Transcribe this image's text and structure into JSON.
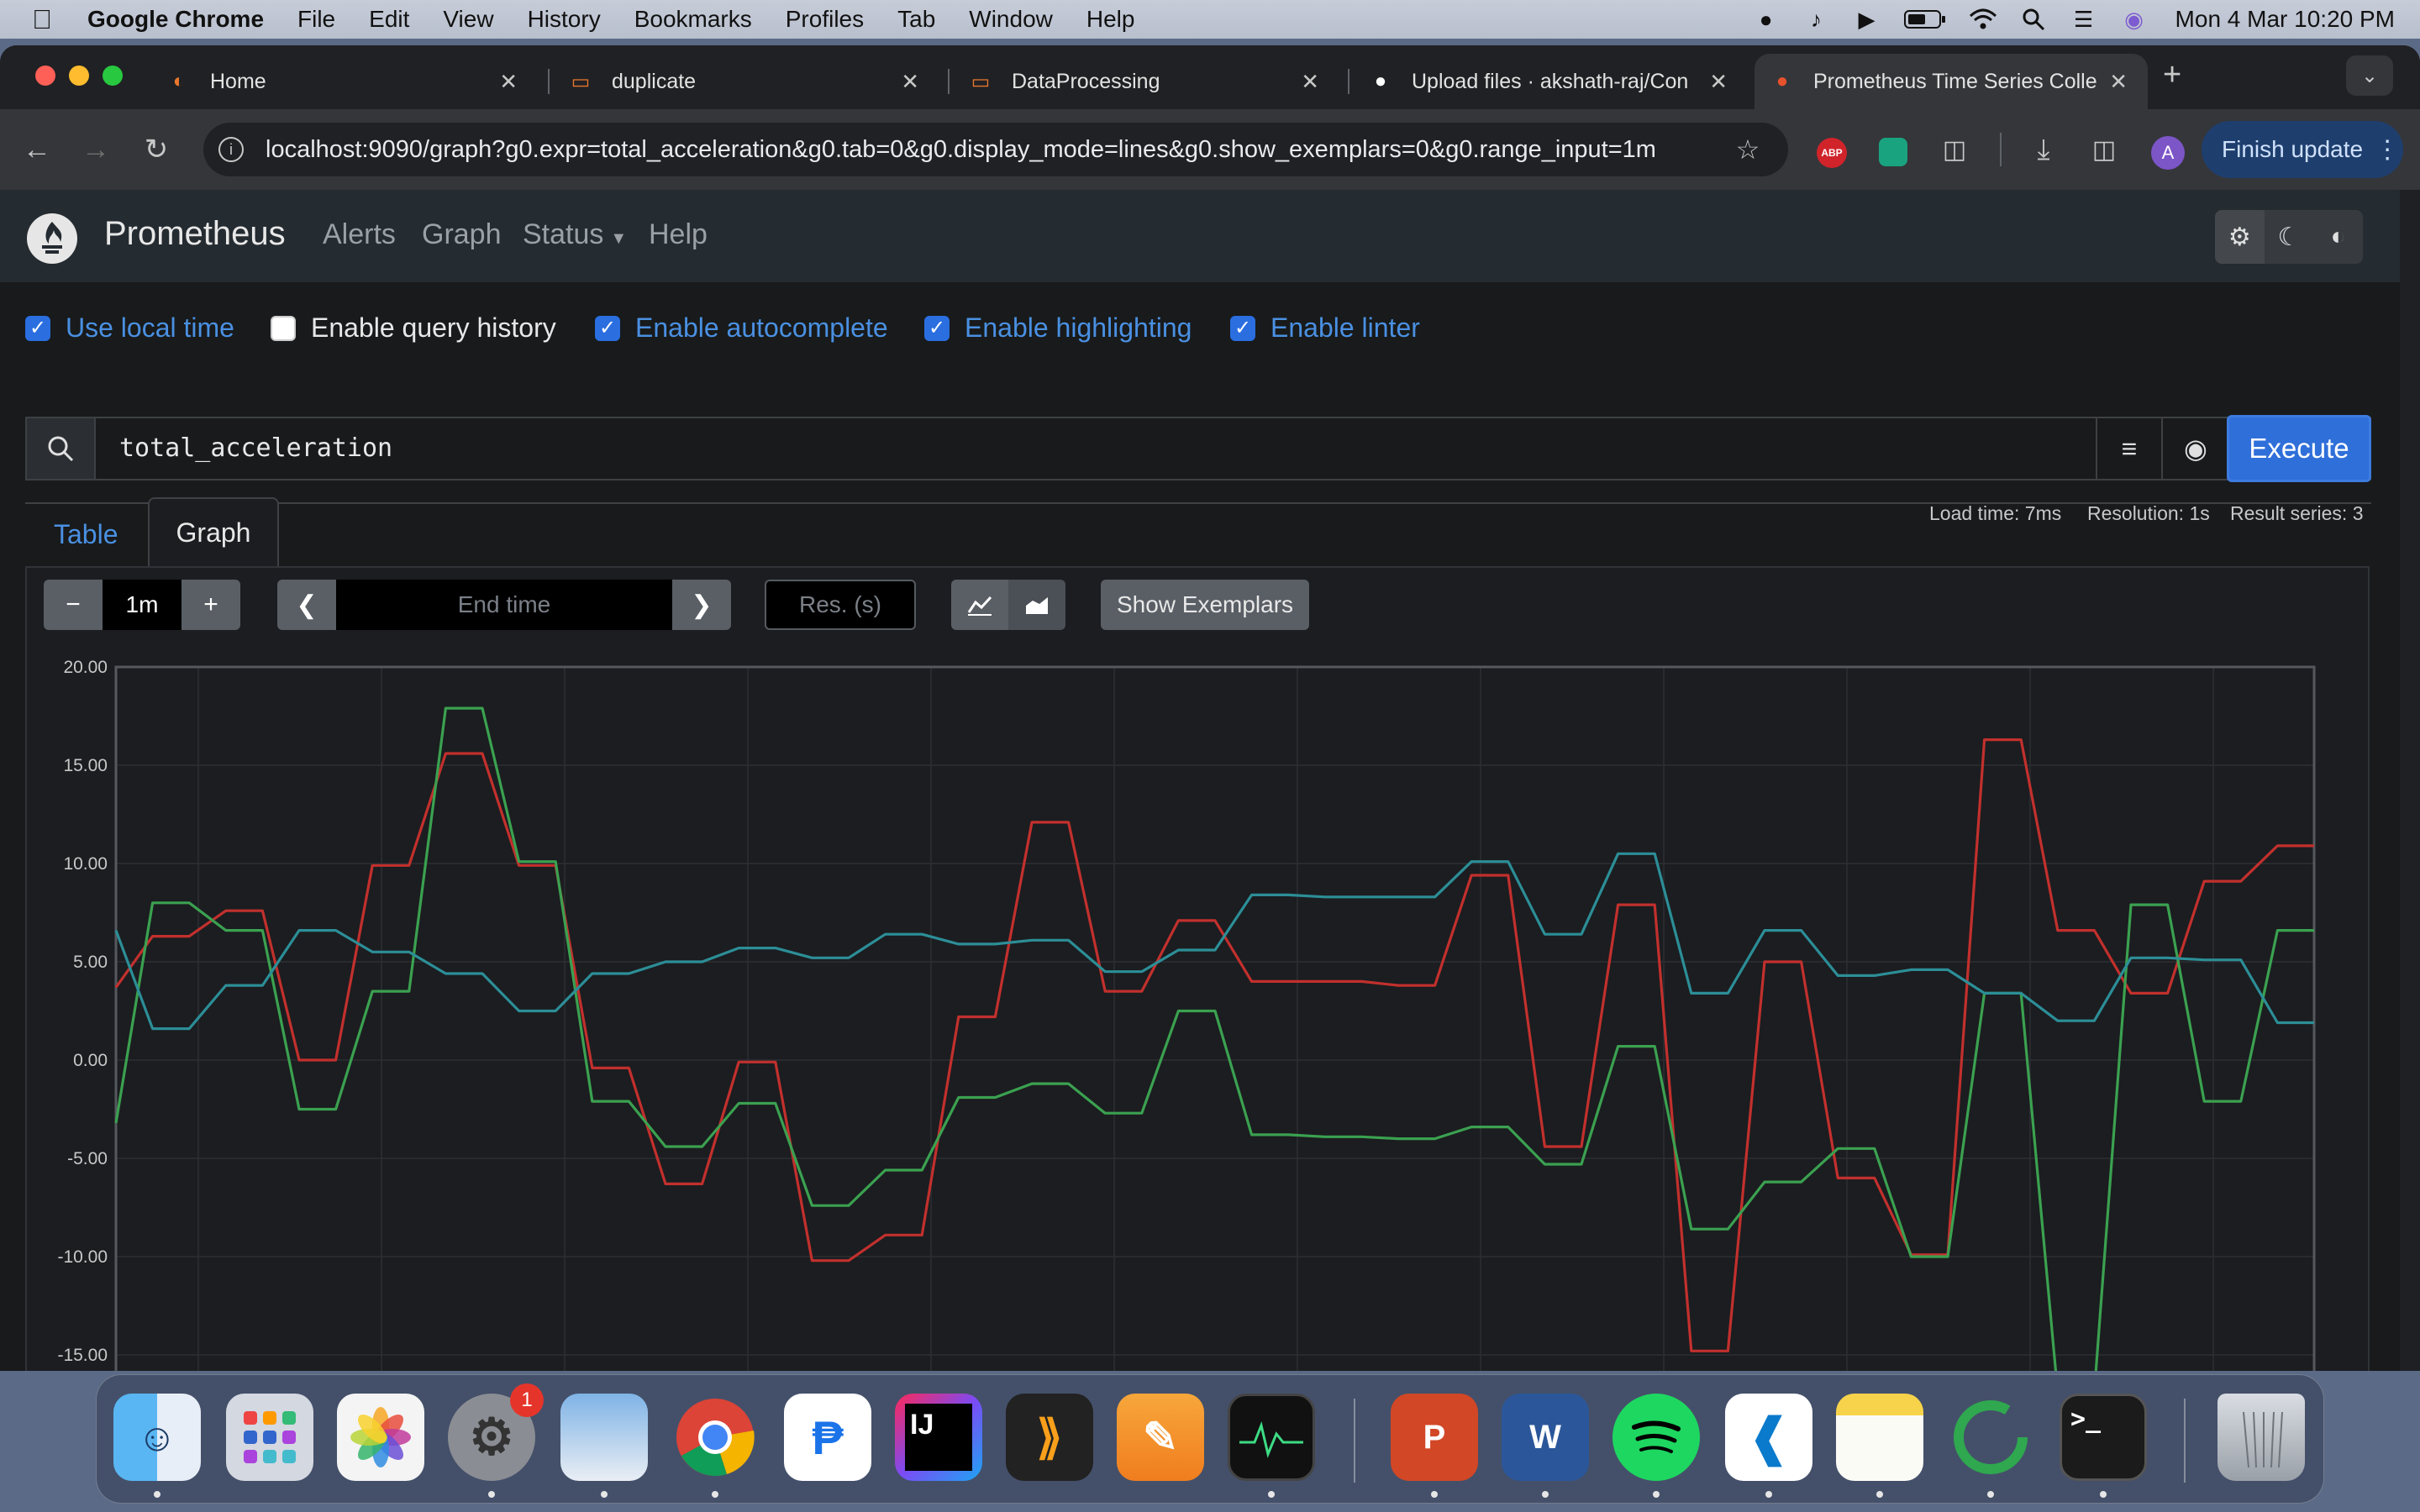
{
  "menubar": {
    "app": "Google Chrome",
    "items": [
      "File",
      "Edit",
      "View",
      "History",
      "Bookmarks",
      "Profiles",
      "Tab",
      "Window",
      "Help"
    ],
    "clock": "Mon 4 Mar  10:20 PM"
  },
  "tabs": [
    {
      "label": "Home"
    },
    {
      "label": "duplicate"
    },
    {
      "label": "DataProcessing"
    },
    {
      "label": "Upload files · akshath-raj/Con"
    },
    {
      "label": "Prometheus Time Series Colle"
    }
  ],
  "toolbar": {
    "url": "localhost:9090/graph?g0.expr=total_acceleration&g0.tab=0&g0.display_mode=lines&g0.show_exemplars=0&g0.range_input=1m",
    "finish_update": "Finish update",
    "avatar_letter": "A",
    "abp_label": "ABP"
  },
  "prometheus": {
    "brand": "Prometheus",
    "nav": [
      "Alerts",
      "Graph",
      "Status",
      "Help"
    ],
    "options": [
      {
        "label": "Use local time",
        "checked": true
      },
      {
        "label": "Enable query history",
        "checked": false
      },
      {
        "label": "Enable autocomplete",
        "checked": true
      },
      {
        "label": "Enable highlighting",
        "checked": true
      },
      {
        "label": "Enable linter",
        "checked": true
      }
    ],
    "query": "total_acceleration",
    "execute_label": "Execute",
    "tabs": [
      "Table",
      "Graph"
    ],
    "stats": {
      "load_time": "Load time: 7ms",
      "resolution": "Resolution: 1s",
      "result_series": "Result series: 3"
    },
    "controls": {
      "minus": "−",
      "range": "1m",
      "plus": "+",
      "end_time_placeholder": "End time",
      "res_placeholder": "Res. (s)",
      "show_exemplars": "Show Exemplars"
    }
  },
  "chart_data": {
    "type": "line",
    "y_ticks": [
      "20.00",
      "15.00",
      "10.00",
      "5.00",
      "0.00",
      "-5.00",
      "-10.00",
      "-15.00"
    ],
    "ylim": [
      -17.5,
      20
    ],
    "x": [
      0,
      1,
      2,
      3,
      4,
      5,
      6,
      7,
      8,
      9,
      10,
      11,
      12,
      13,
      14,
      15,
      16,
      17,
      18,
      19,
      20,
      21,
      22,
      23,
      24,
      25,
      26,
      27,
      28,
      29,
      30,
      31,
      32,
      33,
      34,
      35,
      36,
      37,
      38,
      39,
      40,
      41,
      42,
      43,
      44,
      45,
      46,
      47,
      48,
      49,
      50,
      51,
      52,
      53,
      54,
      55,
      56,
      57,
      58,
      59,
      60
    ],
    "series": [
      {
        "color": "#c2302d",
        "values": [
          3.7,
          6.3,
          6.3,
          7.6,
          7.6,
          0.0,
          0.0,
          9.9,
          9.9,
          15.6,
          15.6,
          9.9,
          9.9,
          -0.4,
          -0.4,
          -6.3,
          -6.3,
          -0.1,
          -0.1,
          -10.2,
          -10.2,
          -8.9,
          -8.9,
          2.2,
          2.2,
          12.1,
          12.1,
          3.5,
          3.5,
          7.1,
          7.1,
          4.0,
          4.0,
          4.0,
          4.0,
          3.8,
          3.8,
          9.4,
          9.4,
          -4.4,
          -4.4,
          7.9,
          7.9,
          -14.8,
          -14.8,
          5.0,
          5.0,
          -6.0,
          -6.0,
          -9.9,
          -9.9,
          16.3,
          16.3,
          6.6,
          6.6,
          3.4,
          3.4,
          9.1,
          9.1,
          10.9,
          10.9
        ]
      },
      {
        "color": "#3ba150",
        "values": [
          -3.2,
          8.0,
          8.0,
          6.6,
          6.6,
          -2.5,
          -2.5,
          3.5,
          3.5,
          17.9,
          17.9,
          10.1,
          10.1,
          -2.1,
          -2.1,
          -4.4,
          -4.4,
          -2.2,
          -2.2,
          -7.4,
          -7.4,
          -5.6,
          -5.6,
          -1.9,
          -1.9,
          -1.2,
          -1.2,
          -2.7,
          -2.7,
          2.5,
          2.5,
          -3.8,
          -3.8,
          -3.9,
          -3.9,
          -4.0,
          -4.0,
          -3.4,
          -3.4,
          -5.3,
          -5.3,
          0.7,
          0.7,
          -8.6,
          -8.6,
          -6.2,
          -6.2,
          -4.5,
          -4.5,
          -10.0,
          -10.0,
          3.4,
          3.4,
          -16.9,
          -16.9,
          7.9,
          7.9,
          -2.1,
          -2.1,
          6.6,
          6.6
        ]
      },
      {
        "color": "#2c8e97",
        "values": [
          6.6,
          1.6,
          1.6,
          3.8,
          3.8,
          6.6,
          6.6,
          5.5,
          5.5,
          4.4,
          4.4,
          2.5,
          2.5,
          4.4,
          4.4,
          5.0,
          5.0,
          5.7,
          5.7,
          5.2,
          5.2,
          6.4,
          6.4,
          5.9,
          5.9,
          6.1,
          6.1,
          4.5,
          4.5,
          5.6,
          5.6,
          8.4,
          8.4,
          8.3,
          8.3,
          8.3,
          8.3,
          10.1,
          10.1,
          6.4,
          6.4,
          10.5,
          10.5,
          3.4,
          3.4,
          6.6,
          6.6,
          4.3,
          4.3,
          4.6,
          4.6,
          3.4,
          3.4,
          2.0,
          2.0,
          5.2,
          5.2,
          5.1,
          5.1,
          1.9,
          1.9
        ]
      }
    ],
    "grid": true
  },
  "dock": {
    "apps": [
      "Finder",
      "Launchpad",
      "Photos",
      "System Settings",
      "Preview",
      "Google Chrome",
      "Instruments",
      "IntelliJ IDEA",
      "Codeforces",
      "Pages",
      "Activity Monitor",
      "PowerPoint",
      "Word",
      "Spotify",
      "Visual Studio Code",
      "Notes",
      "Edge",
      "Terminal",
      "Trash"
    ],
    "badge": "1",
    "ij_label": "IJ",
    "ppt_label": "P",
    "word_label": "W",
    "term_label": ">_"
  },
  "icons": {
    "apple": "apple-icon",
    "colors": {
      "accent": "#2f6fda",
      "navbar": "#242b31"
    }
  }
}
